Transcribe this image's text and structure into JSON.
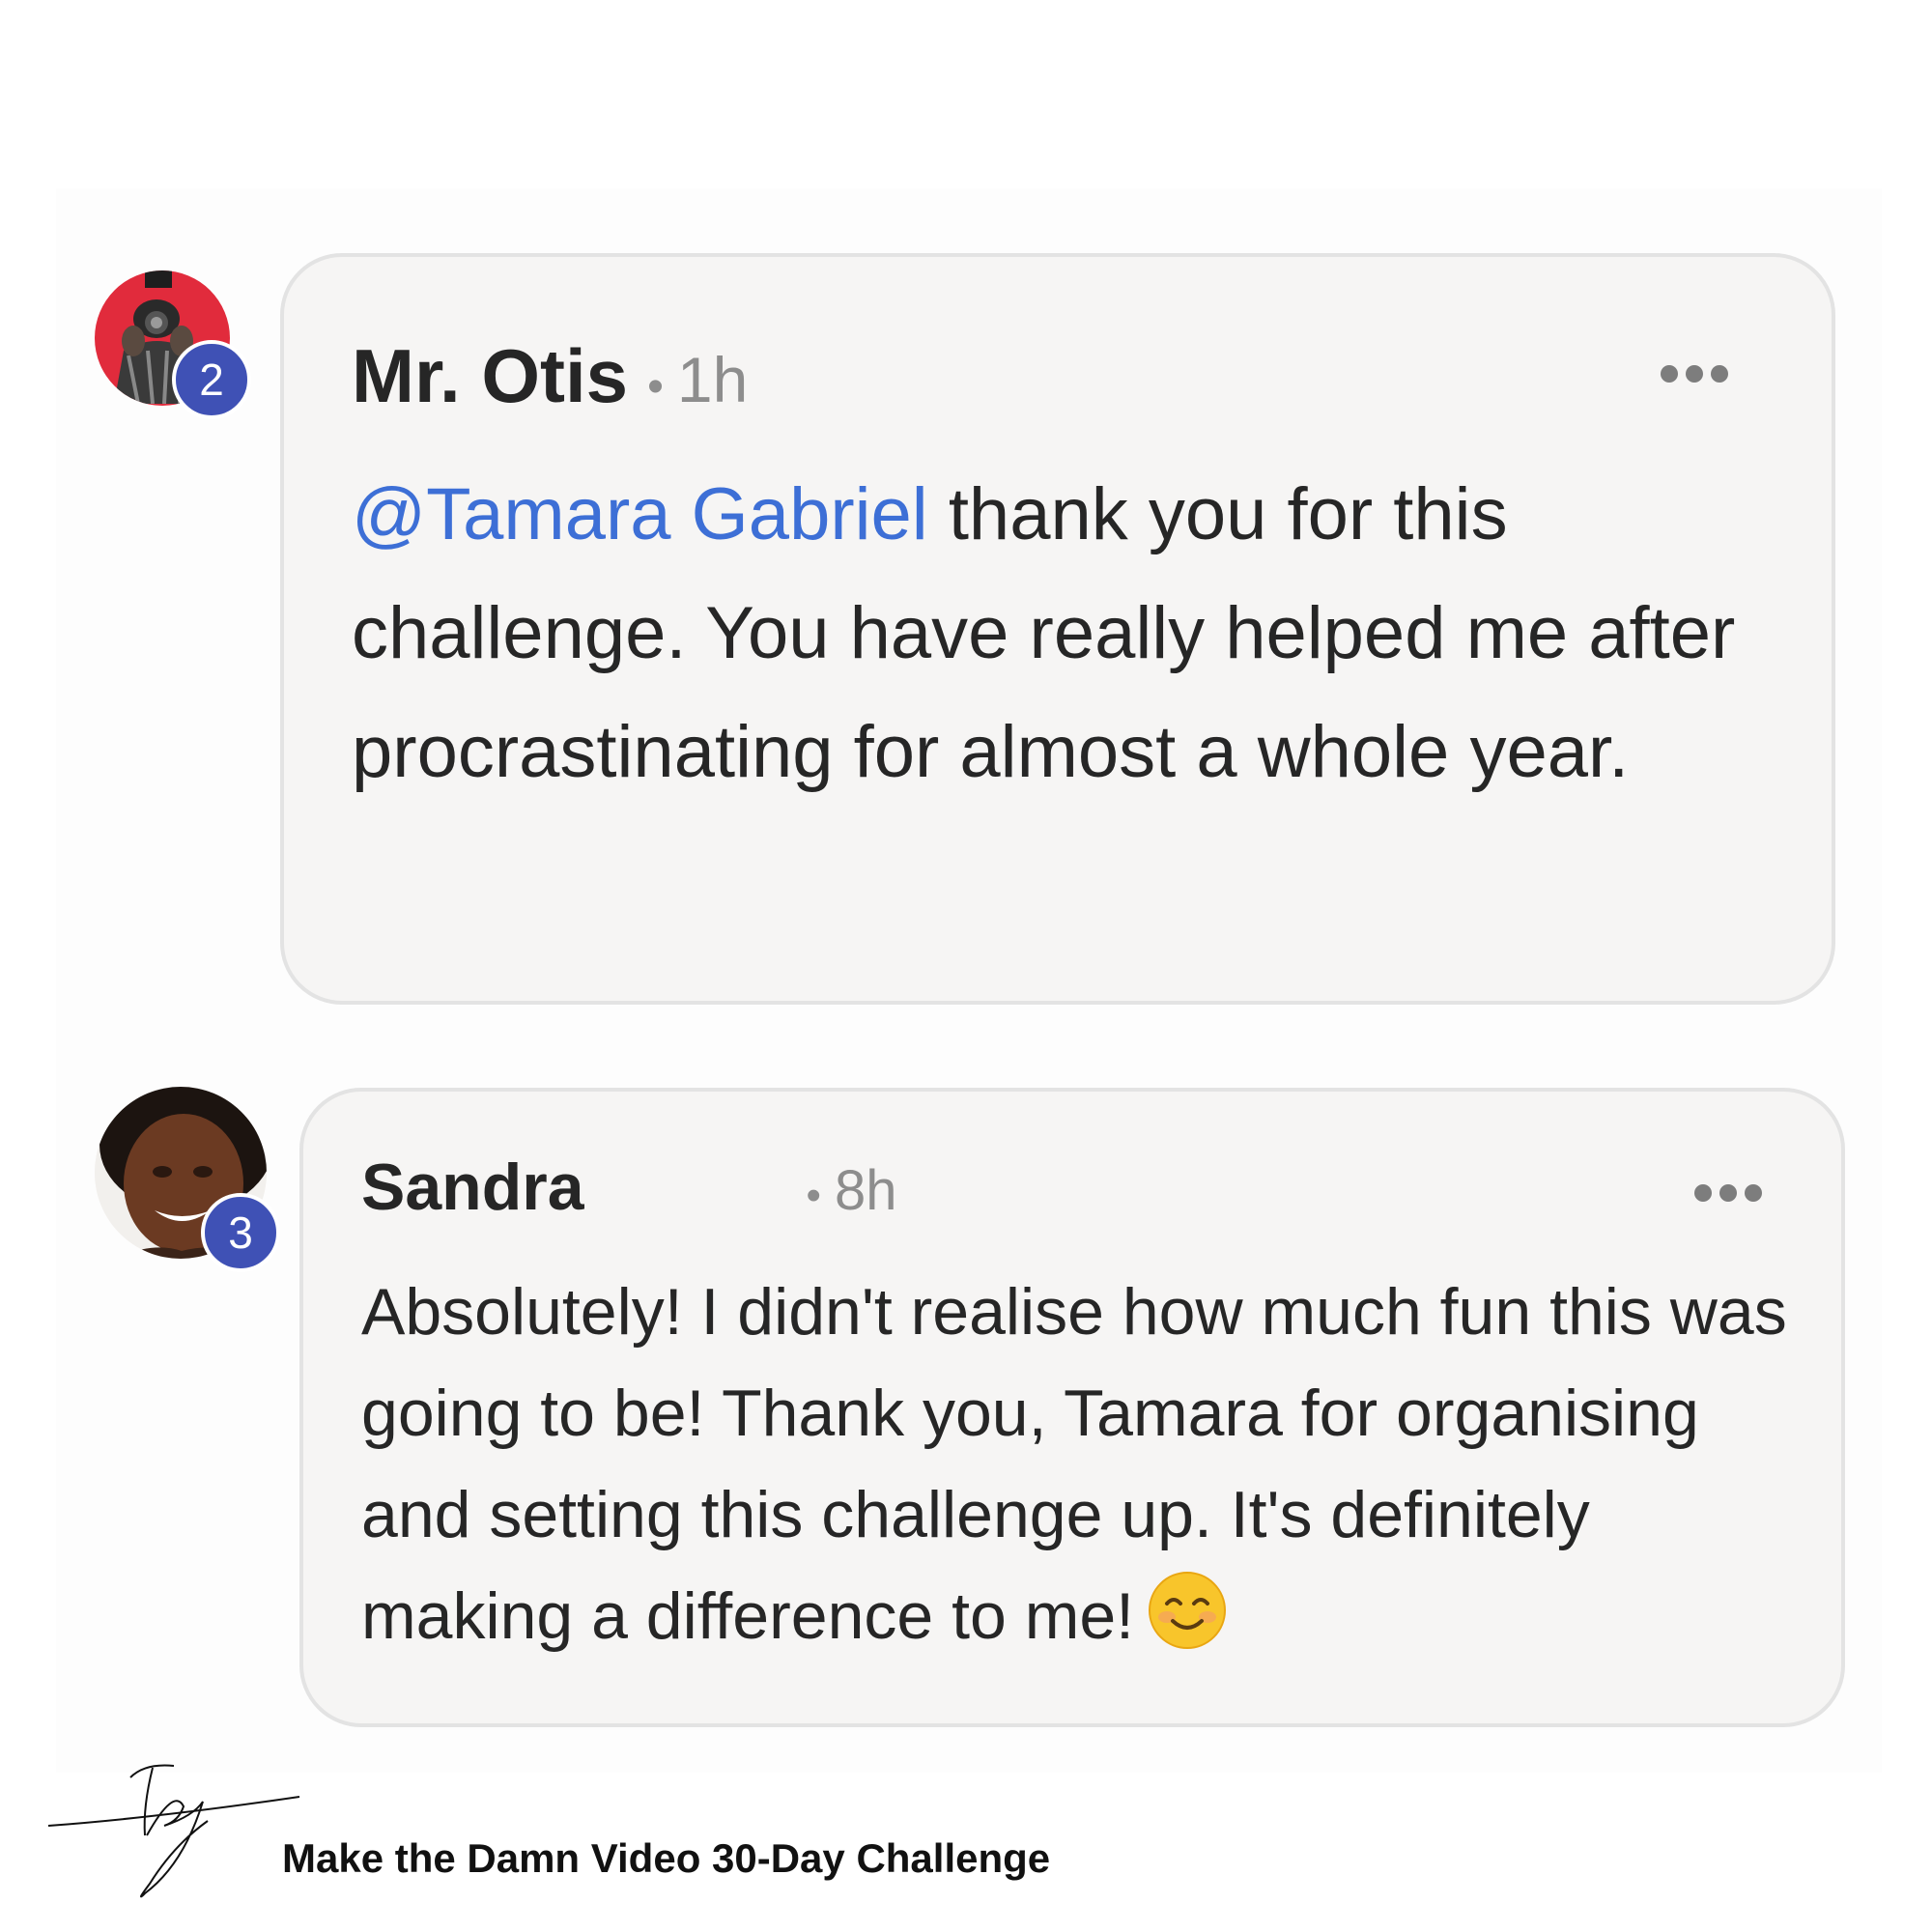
{
  "comments": [
    {
      "author": "Mr. Otis",
      "separator": "•",
      "time": "1h",
      "badge": "2",
      "mention": "@Tamara Gabriel",
      "text": "thank you for this challenge. You have really helped me after procrastinating for almost a whole year.",
      "avatar": "photographer-avatar",
      "avatar_accent": "#e12b3c"
    },
    {
      "author": "Sandra",
      "separator": "•",
      "time": "8h",
      "badge": "3",
      "text": "Absolutely! I didn't realise how much fun this was going to be! Thank you, Tamara for organising and setting this challenge up. It's definitely making a difference to me!",
      "emoji": "smiling-face-icon",
      "avatar": "woman-portrait-avatar"
    }
  ],
  "footer": {
    "logo": "tg",
    "title": "Make the Damn Video 30-Day Challenge"
  },
  "colors": {
    "mention": "#3d6fd6",
    "badge": "#3f51b5",
    "bubble": "#f6f5f4"
  }
}
